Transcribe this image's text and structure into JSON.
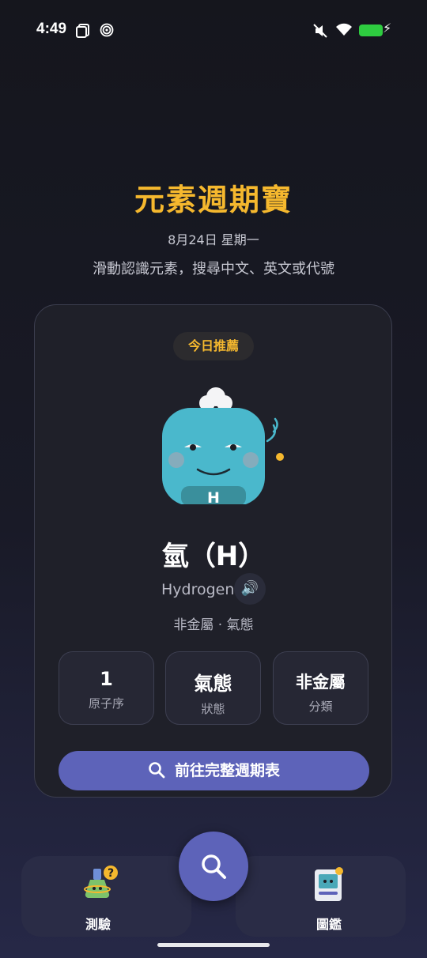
{
  "status_bar": {
    "time": "4:49"
  },
  "header": {
    "title": "元素週期寶",
    "date": "8月24日 星期一",
    "subtitle": "滑動認識元素，搜尋中文、英文或代號"
  },
  "card": {
    "badge": "今日推薦",
    "mascot_symbol": "H",
    "element_name": "氫（H）",
    "english_name": "Hydrogen",
    "meta": "非金屬 · 氣態",
    "stats": [
      {
        "value": "1",
        "label": "原子序"
      },
      {
        "value": "氣態",
        "label": "狀態"
      },
      {
        "value": "非金屬",
        "label": "分類"
      }
    ],
    "goto_button": "前往完整週期表"
  },
  "nav": {
    "left_label": "測驗",
    "right_label": "圖鑑"
  },
  "colors": {
    "accent": "#5d63b9",
    "title": "#f5b82e",
    "mascot": "#4ab8cc"
  },
  "icons": [
    "screen-icon",
    "spiral-icon",
    "mute-icon",
    "wifi-icon",
    "battery-icon",
    "speaker-icon",
    "search-icon",
    "quiz-flask-icon",
    "book-icon"
  ]
}
